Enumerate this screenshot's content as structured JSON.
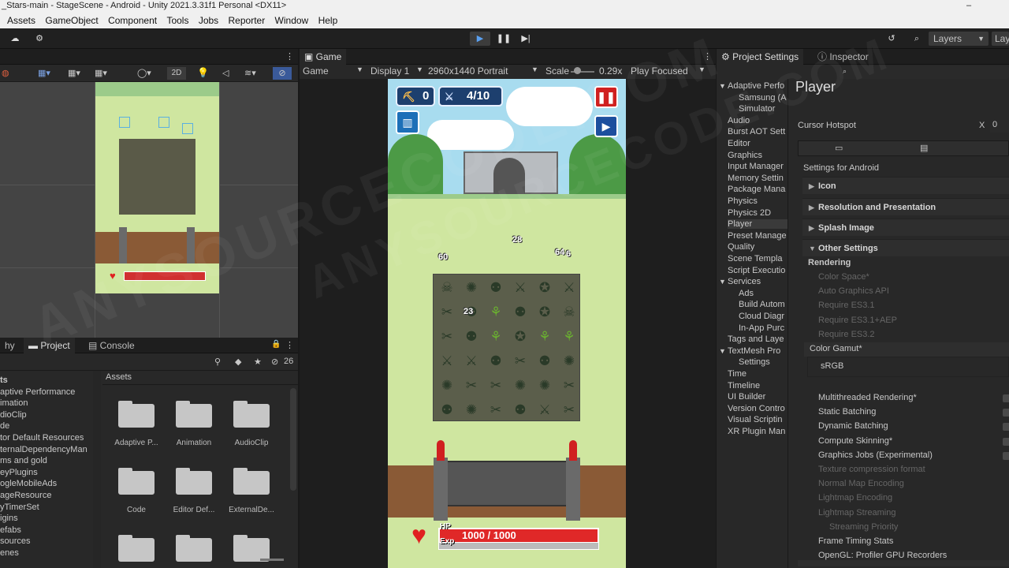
{
  "window": {
    "title": "_Stars-main - StageScene - Android - Unity 2021.3.31f1 Personal <DX11>",
    "minimize": "–"
  },
  "menu": [
    "Assets",
    "GameObject",
    "Component",
    "Tools",
    "Jobs",
    "Reporter",
    "Window",
    "Help"
  ],
  "toolbar": {
    "layers_label": "Layers",
    "layout_label": "Lay"
  },
  "scene": {
    "mode_2d": "2D"
  },
  "game": {
    "tab_label": "Game",
    "mode": "Game",
    "display": "Display 1",
    "resolution": "2960x1440 Portrait",
    "scale_label": "Scale",
    "scale_value": "0.29x",
    "play_focused": "Play Focused",
    "hud": {
      "coins": "0",
      "waves": "4/10",
      "hp_label": "HP",
      "hp_value": "1000 / 1000",
      "exp_label": "Exp",
      "hp_fraction": 1.0,
      "exp_fraction": 0.0
    },
    "damage_numbers": [
      "60",
      "28",
      "64",
      "6",
      "23"
    ]
  },
  "project": {
    "tabs": [
      "hy",
      "Project",
      "Console"
    ],
    "hidden_count": "26",
    "breadcrumb": "Assets",
    "tree": [
      "ts",
      "aptive Performance",
      "imation",
      "dioClip",
      "de",
      "tor Default Resources",
      "ternalDependencyMan",
      "ms and gold",
      "eyPlugins",
      "ogleMobileAds",
      "ageResource",
      "yTimerSet",
      "igins",
      "efabs",
      "sources",
      "enes"
    ],
    "folders": [
      "Adaptive P...",
      "Animation",
      "AudioClip",
      "Code",
      "Editor Def...",
      "ExternalDe...",
      "",
      "",
      ""
    ]
  },
  "project_settings": {
    "tab_label": "Project Settings",
    "items": [
      "Adaptive Perfo",
      "Samsung (A",
      "Simulator",
      "Audio",
      "Burst AOT Sett",
      "Editor",
      "Graphics",
      "Input Manager",
      "Memory Settin",
      "Package Mana",
      "Physics",
      "Physics 2D",
      "Player",
      "Preset Manage",
      "Quality",
      "Scene Templa",
      "Script Executio",
      "Services",
      "Ads",
      "Build Autom",
      "Cloud Diagr",
      "In-App Purc",
      "Tags and Laye",
      "TextMesh Pro",
      "Settings",
      "Time",
      "Timeline",
      "UI Builder",
      "Version Contro",
      "Visual Scriptin",
      "XR Plugin Man"
    ]
  },
  "inspector": {
    "tab_label": "Inspector",
    "title": "Player",
    "cursor_hotspot": "Cursor Hotspot",
    "x_label": "X",
    "x_value": "0",
    "settings_for": "Settings for Android",
    "sections": [
      "Icon",
      "Resolution and Presentation",
      "Splash Image",
      "Other Settings"
    ],
    "rendering": "Rendering",
    "rows": [
      "Color Space*",
      "Auto Graphics API",
      "Require ES3.1",
      "Require ES3.1+AEP",
      "Require ES3.2"
    ],
    "color_gamut": "Color Gamut*",
    "srgb": "sRGB",
    "options": [
      "Multithreaded Rendering*",
      "Static Batching",
      "Dynamic Batching",
      "Compute Skinning*",
      "Graphics Jobs (Experimental)",
      "Texture compression format",
      "Normal Map Encoding",
      "Lightmap Encoding",
      "Lightmap Streaming",
      "Streaming Priority",
      "Frame Timing Stats",
      "OpenGL: Profiler GPU Recorders"
    ]
  },
  "watermark": "ANYSOURCECODE.COM"
}
